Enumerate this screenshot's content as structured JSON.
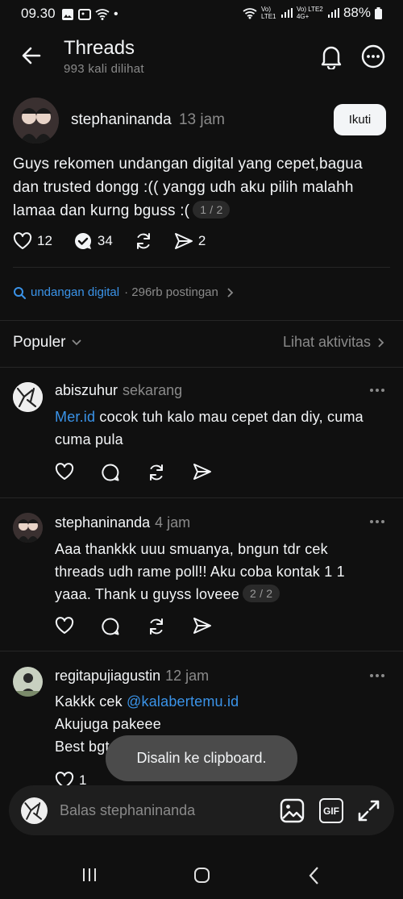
{
  "status_bar": {
    "time": "09.30",
    "dot": "•",
    "signal_1": "Vo) LTE1",
    "signal_2": "Vo) LTE2 4G+",
    "battery": "88%"
  },
  "header": {
    "title": "Threads",
    "subtitle": "993 kali dilihat"
  },
  "post": {
    "username": "stephaninanda",
    "time": "13 jam",
    "follow_label": "Ikuti",
    "line1": "Guys rekomen undangan digital yang cepet,bagua",
    "line2": "dan trusted dongg :(( yangg udh aku pilih malahh",
    "line3": "lamaa dan kurng bguss :(",
    "page_indicator": "1 / 2",
    "likes": "12",
    "replies": "34",
    "shares": "2"
  },
  "topic": {
    "name": "undangan digital",
    "meta": "· 296rb postingan"
  },
  "sort": {
    "label": "Populer",
    "activity_link": "Lihat aktivitas"
  },
  "replies": [
    {
      "username": "abiszuhur",
      "time": "sekarang",
      "link": "Mer.id",
      "line1_rest": " cocok tuh kalo mau cepet dan diy, cuma",
      "line2": "cuma pula"
    },
    {
      "username": "stephaninanda",
      "time": "4 jam",
      "line1": "Aaa thankkk uuu smuanya, bngun tdr cek",
      "line2": "threads udh rame poll!! Aku coba kontak 1 1",
      "line3": "yaaa. Thank u guyss loveee",
      "page_indicator": "2 / 2"
    },
    {
      "username": "regitapujiagustin",
      "time": "12 jam",
      "line1_pre": "Kakkk cek ",
      "mention": "@kalabertemu.id",
      "line2": "Akujuga pakeee",
      "line3": "Best bgt gercenpp",
      "likes": "1"
    }
  ],
  "toast": "Disalin ke clipboard.",
  "reply_bar": {
    "placeholder": "Balas stephaninanda",
    "gif_label": "GIF"
  },
  "colors": {
    "background": "#101010",
    "link": "#3a93e8",
    "muted": "#8a8a8a",
    "toast_bg": "#4b4b4b"
  }
}
